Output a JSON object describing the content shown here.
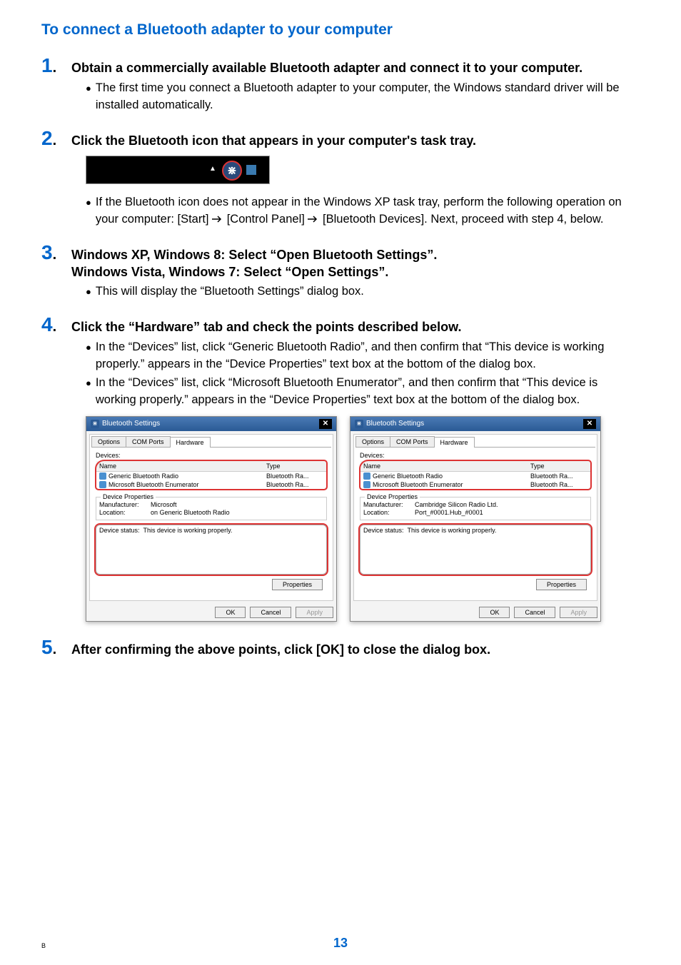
{
  "title": "To connect a Bluetooth adapter to your computer",
  "steps": {
    "s1": {
      "num": "1",
      "text": "Obtain a commercially available Bluetooth adapter and connect it to your computer."
    },
    "s1b1": "The first time you connect a Bluetooth adapter to your computer, the Windows standard driver will be installed automatically.",
    "s2": {
      "num": "2",
      "text": "Click the Bluetooth icon that appears in your computer's task tray."
    },
    "s2b1a": "If the Bluetooth icon does not appear in the Windows XP task tray, perform the following operation on your computer: [Start] ",
    "s2b1b": " [Control Panel] ",
    "s2b1c": " [Bluetooth Devices]. Next, proceed with step 4, below.",
    "s3": {
      "num": "3",
      "text": "Windows XP, Windows 8: Select “Open Bluetooth Settings”.\nWindows Vista, Windows 7: Select “Open Settings”."
    },
    "s3b1": "This will display the “Bluetooth Settings” dialog box.",
    "s4": {
      "num": "4",
      "text": "Click the “Hardware” tab and check the points described below."
    },
    "s4b1": "In the “Devices” list, click “Generic Bluetooth Radio”, and then confirm that “This device is working properly.” appears in the “Device Properties” text box at the bottom of the dialog box.",
    "s4b2": "In the “Devices” list, click “Microsoft Bluetooth Enumerator”, and then confirm that “This device is working properly.” appears in the “Device Properties” text box at the bottom of the dialog box.",
    "s5": {
      "num": "5",
      "text": "After confirming the above points, click [OK] to close the dialog box."
    }
  },
  "dialog": {
    "title": "Bluetooth Settings",
    "tabs": {
      "options": "Options",
      "com": "COM Ports",
      "hardware": "Hardware"
    },
    "devices_label": "Devices:",
    "col_name": "Name",
    "col_type": "Type",
    "dev1": "Generic Bluetooth Radio",
    "dev2": "Microsoft Bluetooth Enumerator",
    "type1": "Bluetooth Ra...",
    "type2": "Bluetooth Ra...",
    "props_legend": "Device Properties",
    "left": {
      "mfr_label": "Manufacturer:",
      "mfr": "Microsoft",
      "loc_label": "Location:",
      "loc": "on Generic Bluetooth Radio"
    },
    "right": {
      "mfr_label": "Manufacturer:",
      "mfr": "Cambridge Silicon Radio Ltd.",
      "loc_label": "Location:",
      "loc": "Port_#0001.Hub_#0001"
    },
    "status_label": "Device status:",
    "status_text": "This device is working properly.",
    "btn_props": "Properties",
    "btn_ok": "OK",
    "btn_cancel": "Cancel",
    "btn_apply": "Apply"
  },
  "page": {
    "number": "13",
    "footer_b": "B"
  }
}
